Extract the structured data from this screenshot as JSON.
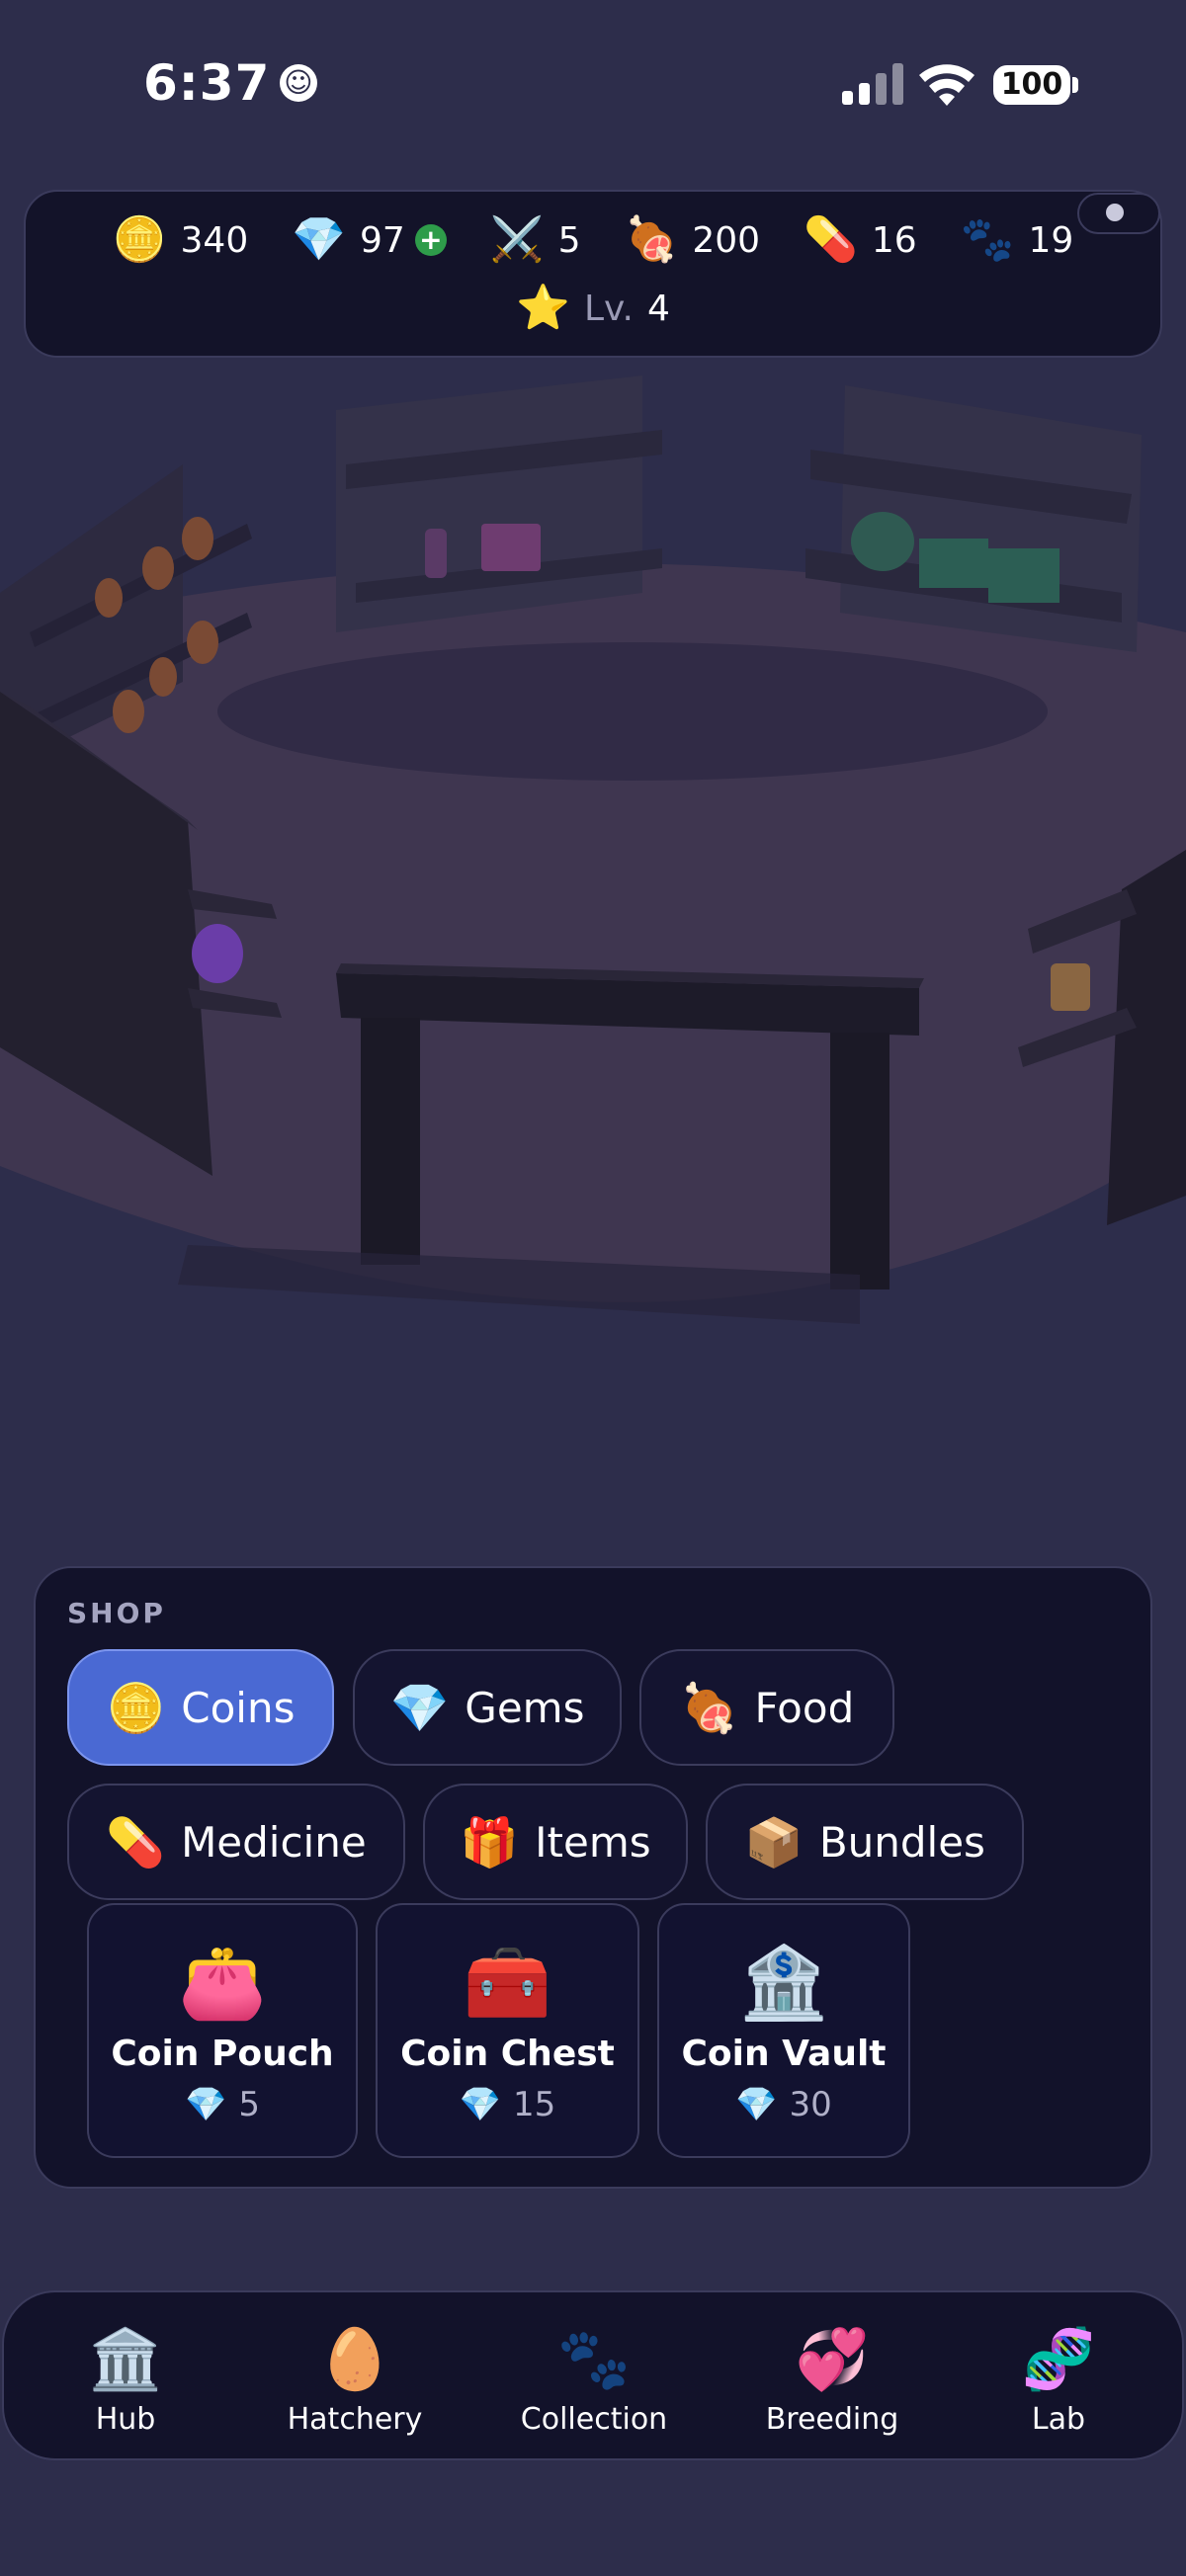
{
  "status_bar": {
    "time": "6:37",
    "battery": "100"
  },
  "resources": [
    {
      "id": "coins",
      "icon": "🪙",
      "value": "340"
    },
    {
      "id": "gems",
      "icon": "💎",
      "value": "97",
      "plus": "+"
    },
    {
      "id": "swords",
      "icon": "⚔️",
      "value": "5"
    },
    {
      "id": "food",
      "icon": "🍖",
      "value": "200"
    },
    {
      "id": "medicine",
      "icon": "💊",
      "value": "16"
    },
    {
      "id": "paws",
      "icon": "🐾",
      "value": "19"
    }
  ],
  "level": {
    "icon": "⭐",
    "label": "Lv.",
    "value": "4"
  },
  "shop": {
    "title": "SHOP",
    "categories": [
      {
        "icon": "🪙",
        "label": "Coins",
        "active": true
      },
      {
        "icon": "💎",
        "label": "Gems"
      },
      {
        "icon": "🍖",
        "label": "Food"
      },
      {
        "icon": "💊",
        "label": "Medicine"
      },
      {
        "icon": "🎁",
        "label": "Items"
      },
      {
        "icon": "📦",
        "label": "Bundles"
      }
    ],
    "products": [
      {
        "icon": "👛",
        "name": "Coin Pouch",
        "price_icon": "💎",
        "price": "5"
      },
      {
        "icon": "🧰",
        "name": "Coin Chest",
        "price_icon": "💎",
        "price": "15"
      },
      {
        "icon": "🏦",
        "name": "Coin Vault",
        "price_icon": "💎",
        "price": "30"
      }
    ]
  },
  "nav": [
    {
      "icon": "🏛️",
      "label": "Hub"
    },
    {
      "icon": "🥚",
      "label": "Hatchery"
    },
    {
      "icon": "🐾",
      "label": "Collection"
    },
    {
      "icon": "💞",
      "label": "Breeding"
    },
    {
      "icon": "🧬",
      "label": "Lab"
    }
  ],
  "colors": {
    "background": "#2d2d4b",
    "panel": "#12122a",
    "accent": "#4a69d3",
    "plus_badge": "#2e9c4a"
  }
}
